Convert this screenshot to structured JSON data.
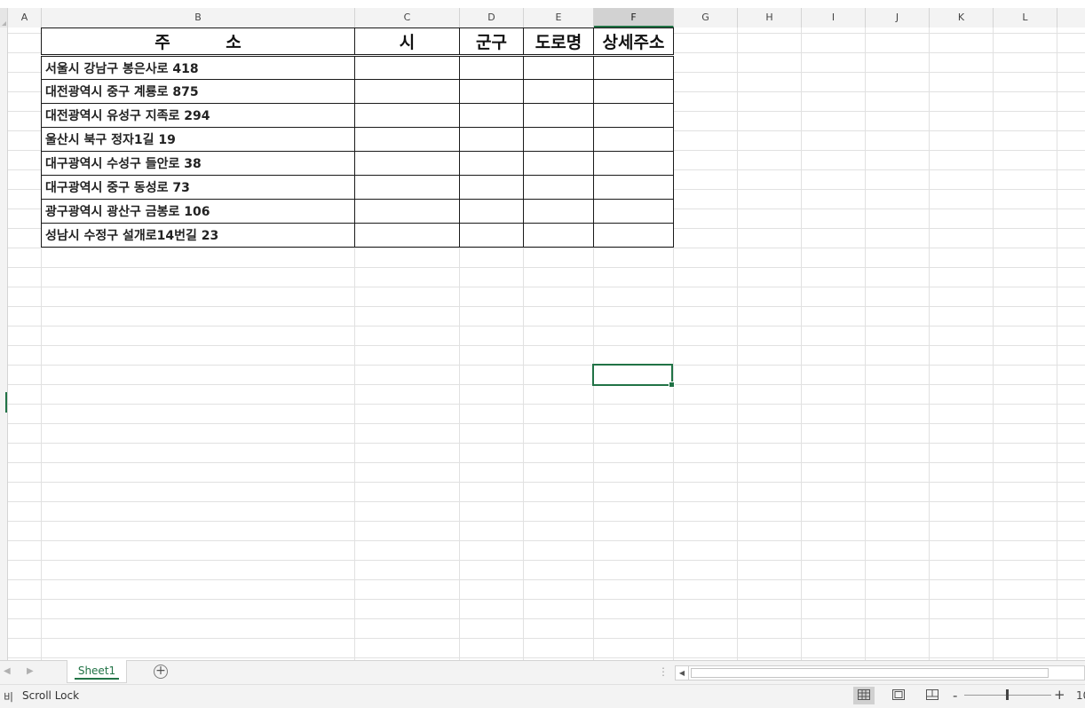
{
  "columns": [
    "A",
    "B",
    "C",
    "D",
    "E",
    "F",
    "G",
    "H",
    "I",
    "J",
    "K",
    "L"
  ],
  "selected_column": "F",
  "table": {
    "headers": [
      "주 소",
      "시",
      "군구",
      "도로명",
      "상세주소"
    ],
    "rows": [
      [
        "서울시 강남구 봉은사로 418",
        "",
        "",
        "",
        ""
      ],
      [
        "대전광역시 중구 계룡로 875",
        "",
        "",
        "",
        ""
      ],
      [
        "대전광역시 유성구 지족로 294",
        "",
        "",
        "",
        ""
      ],
      [
        "울산시 북구 정자1길 19",
        "",
        "",
        "",
        ""
      ],
      [
        "대구광역시 수성구 들안로 38",
        "",
        "",
        "",
        ""
      ],
      [
        "대구광역시 중구 동성로 73",
        "",
        "",
        "",
        ""
      ],
      [
        "광구광역시 광산구 금봉로 106",
        "",
        "",
        "",
        ""
      ],
      [
        "성남시 수정구 설개로14번길 23",
        "",
        "",
        "",
        ""
      ]
    ]
  },
  "tabs": {
    "sheet1": "Sheet1",
    "add_icon": "plus-circle-icon"
  },
  "status": {
    "left_partial": "비",
    "scroll_lock": "Scroll Lock",
    "view_icons": [
      "normal-view-icon",
      "page-layout-icon",
      "page-break-preview-icon"
    ],
    "zoom_minus": "-",
    "zoom_plus": "+",
    "zoom_partial": "10"
  }
}
